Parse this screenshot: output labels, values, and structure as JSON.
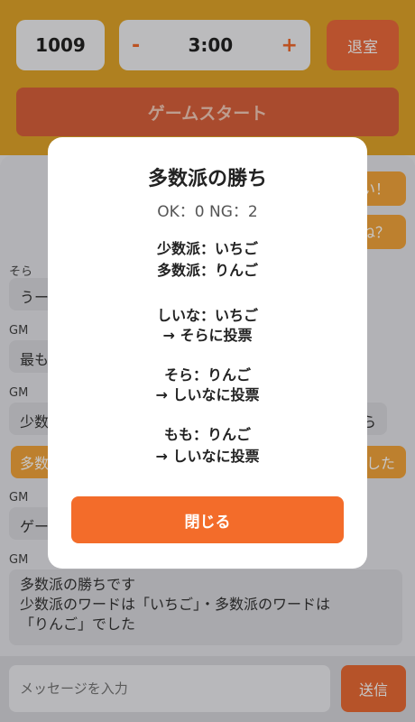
{
  "header": {
    "room_id": "1009",
    "minus": "-",
    "timer": "3:00",
    "plus": "+",
    "exit_label": "退室",
    "start_label": "ゲームスタート"
  },
  "chat": {
    "right_1": "い！",
    "right_2": "ね？",
    "msg1_sender": "そら",
    "msg1_text": "うー",
    "msg2_sender": "GM",
    "msg2_text": "最も",
    "msg3_sender": "GM",
    "msg3_text": "少数",
    "msg3_tail": "ら",
    "orange_left": "多数",
    "orange_right": "した",
    "msg4_sender": "GM",
    "msg4_text": "ゲー",
    "msg5_sender": "GM",
    "msg5_line1": "多数派の勝ちです",
    "msg5_line2": "少数派のワードは「いちご」・多数派のワードは",
    "msg5_line3": "「りんご」でした"
  },
  "composer": {
    "placeholder": "メッセージを入力",
    "send_label": "送信"
  },
  "modal": {
    "title": "多数派の勝ち",
    "score": "OK：0 NG：2",
    "minority": "少数派：いちご",
    "majority": "多数派：りんご",
    "p1_word": "しいな：いちご",
    "p1_vote": "→ そらに投票",
    "p2_word": "そら：りんご",
    "p2_vote": "→ しいなに投票",
    "p3_word": "もも：りんご",
    "p3_vote": "→ しいなに投票",
    "close_label": "閉じる"
  }
}
